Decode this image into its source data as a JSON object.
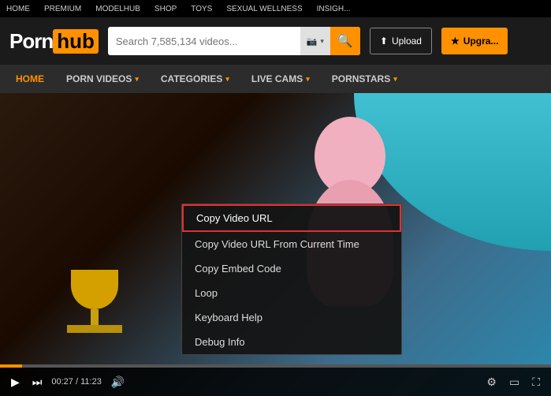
{
  "top_nav": {
    "items": [
      {
        "label": "HOME",
        "id": "home"
      },
      {
        "label": "PREMIUM",
        "id": "premium"
      },
      {
        "label": "MODELHUB",
        "id": "modelhub"
      },
      {
        "label": "SHOP",
        "id": "shop"
      },
      {
        "label": "TOYS",
        "id": "toys"
      },
      {
        "label": "SEXUAL WELLNESS",
        "id": "sexual-wellness"
      },
      {
        "label": "INSIGH...",
        "id": "insights"
      }
    ]
  },
  "header": {
    "logo_porn": "Porn",
    "logo_hub": "hub",
    "search_placeholder": "Search 7,585,134 videos...",
    "upload_label": "Upload",
    "upgrade_label": "Upgra..."
  },
  "sec_nav": {
    "items": [
      {
        "label": "HOME",
        "id": "home",
        "active": true
      },
      {
        "label": "PORN VIDEOS",
        "id": "porn-videos",
        "dropdown": true
      },
      {
        "label": "CATEGORIES",
        "id": "categories",
        "dropdown": true
      },
      {
        "label": "LIVE CAMS",
        "id": "live-cams",
        "dropdown": true
      },
      {
        "label": "PORNSTARS",
        "id": "pornstars",
        "dropdown": true
      }
    ]
  },
  "context_menu": {
    "items": [
      {
        "label": "Copy Video URL",
        "highlighted": true
      },
      {
        "label": "Copy Video URL From Current Time",
        "highlighted": false
      },
      {
        "label": "Copy Embed Code",
        "highlighted": false
      },
      {
        "label": "Loop",
        "highlighted": false
      },
      {
        "label": "Keyboard Help",
        "highlighted": false
      },
      {
        "label": "Debug Info",
        "highlighted": false
      }
    ]
  },
  "video_controls": {
    "play_icon": "▶",
    "skip_icon": "⏭",
    "time_current": "00:27",
    "time_total": "11:23",
    "volume_icon": "🔊",
    "settings_icon": "⚙",
    "theater_icon": "▭",
    "fullscreen_icon": "⛶"
  }
}
